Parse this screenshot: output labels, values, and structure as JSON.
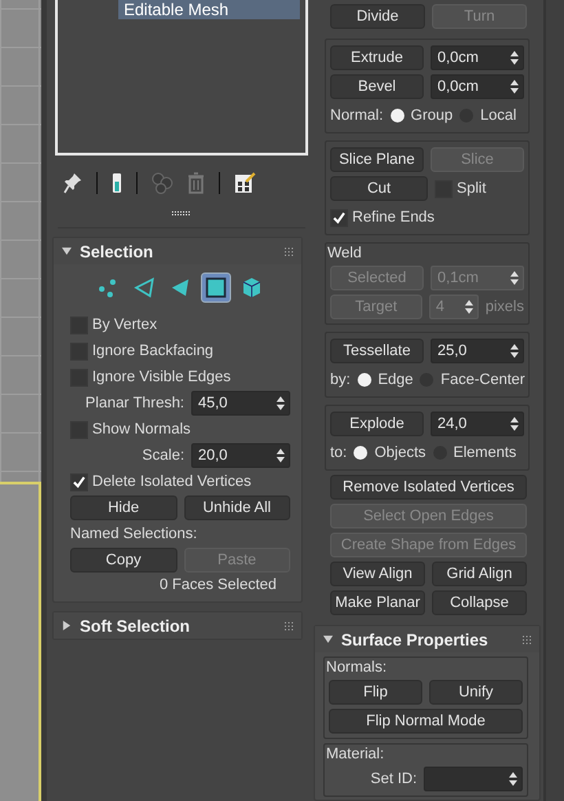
{
  "modifier_stack": {
    "items": [
      {
        "label": "Editable Mesh",
        "selected": true
      }
    ]
  },
  "selection": {
    "title": "Selection",
    "expanded": true,
    "levels": [
      {
        "selected": false
      },
      {
        "selected": false
      },
      {
        "selected": false
      },
      {
        "selected": true
      },
      {
        "selected": false
      }
    ],
    "rows": [
      {
        "kind": "check",
        "label": "By Vertex",
        "checked": false
      },
      {
        "kind": "check",
        "label": "Ignore Backfacing",
        "checked": false
      },
      {
        "kind": "check",
        "label": "Ignore Visible Edges",
        "checked": false
      },
      {
        "kind": "spinner",
        "label": "Planar Thresh:",
        "value": "45,0"
      },
      {
        "kind": "check",
        "label": "Show Normals",
        "checked": false
      },
      {
        "kind": "spinner",
        "label": "Scale:",
        "value": "20,0"
      },
      {
        "kind": "check",
        "label": "Delete Isolated Vertices",
        "checked": true
      },
      {
        "kind": "buttons",
        "buttons": [
          {
            "label": "Hide",
            "disabled": false
          },
          {
            "label": "Unhide All",
            "disabled": false
          }
        ]
      },
      {
        "kind": "label",
        "label": "Named Selections:"
      },
      {
        "kind": "buttons",
        "buttons": [
          {
            "label": "Copy",
            "disabled": false
          },
          {
            "label": "Paste",
            "disabled": true
          }
        ]
      },
      {
        "kind": "status",
        "label": "0 Faces Selected"
      }
    ]
  },
  "soft_selection": {
    "title": "Soft Selection",
    "expanded": false
  },
  "edit_geometry": [
    {
      "kind": "plain",
      "rows": [
        {
          "kind": "buttons",
          "buttons": [
            {
              "label": "Divide",
              "disabled": false
            },
            {
              "label": "Turn",
              "disabled": true
            }
          ]
        }
      ]
    },
    {
      "kind": "box",
      "rows": [
        {
          "kind": "button_spinner",
          "button": {
            "label": "Extrude",
            "disabled": false
          },
          "value": "0,0cm",
          "disabled": false
        },
        {
          "kind": "button_spinner",
          "button": {
            "label": "Bevel",
            "disabled": false
          },
          "value": "0,0cm",
          "disabled": false
        },
        {
          "kind": "radio",
          "label": "Normal:",
          "options": [
            {
              "label": "Group",
              "selected": true
            },
            {
              "label": "Local",
              "selected": false
            }
          ]
        }
      ]
    },
    {
      "kind": "box",
      "rows": [
        {
          "kind": "buttons",
          "buttons": [
            {
              "label": "Slice Plane",
              "disabled": false
            },
            {
              "label": "Slice",
              "disabled": true
            }
          ]
        },
        {
          "kind": "button_check",
          "button": {
            "label": "Cut",
            "disabled": false
          },
          "check": {
            "label": "Split",
            "checked": false
          }
        },
        {
          "kind": "check",
          "label": "Refine Ends",
          "checked": true
        }
      ]
    },
    {
      "kind": "box",
      "title": "Weld",
      "rows": [
        {
          "kind": "button_spinner",
          "button": {
            "label": "Selected",
            "disabled": true
          },
          "value": "0,1cm",
          "disabled": true
        },
        {
          "kind": "button_spinner",
          "button": {
            "label": "Target",
            "disabled": true
          },
          "value": "4",
          "unit": "pixels",
          "disabled": true
        }
      ]
    },
    {
      "kind": "box",
      "rows": [
        {
          "kind": "button_spinner",
          "button": {
            "label": "Tessellate",
            "disabled": false
          },
          "value": "25,0",
          "disabled": false
        },
        {
          "kind": "radio",
          "label": "by:",
          "options": [
            {
              "label": "Edge",
              "selected": true
            },
            {
              "label": "Face-Center",
              "selected": false
            }
          ]
        }
      ]
    },
    {
      "kind": "box",
      "rows": [
        {
          "kind": "button_spinner",
          "button": {
            "label": "Explode",
            "disabled": false
          },
          "value": "24,0",
          "disabled": false
        },
        {
          "kind": "radio",
          "label": "to:",
          "options": [
            {
              "label": "Objects",
              "selected": true
            },
            {
              "label": "Elements",
              "selected": false
            }
          ]
        }
      ]
    },
    {
      "kind": "plain",
      "rows": [
        {
          "kind": "buttons",
          "buttons": [
            {
              "label": "Remove Isolated Vertices",
              "disabled": false
            }
          ]
        },
        {
          "kind": "buttons",
          "buttons": [
            {
              "label": "Select Open Edges",
              "disabled": true
            }
          ]
        },
        {
          "kind": "buttons",
          "buttons": [
            {
              "label": "Create Shape from Edges",
              "disabled": true
            }
          ]
        },
        {
          "kind": "buttons",
          "buttons": [
            {
              "label": "View Align",
              "disabled": false
            },
            {
              "label": "Grid Align",
              "disabled": false
            }
          ]
        },
        {
          "kind": "buttons",
          "buttons": [
            {
              "label": "Make Planar",
              "disabled": false
            },
            {
              "label": "Collapse",
              "disabled": false
            }
          ]
        }
      ]
    }
  ],
  "surface_properties": {
    "title": "Surface Properties",
    "expanded": true,
    "groups": [
      {
        "kind": "box",
        "title": "Normals:",
        "rows": [
          {
            "kind": "buttons",
            "buttons": [
              {
                "label": "Flip",
                "disabled": false
              },
              {
                "label": "Unify",
                "disabled": false
              }
            ]
          },
          {
            "kind": "buttons",
            "buttons": [
              {
                "label": "Flip Normal Mode",
                "disabled": false
              }
            ]
          }
        ]
      },
      {
        "kind": "box",
        "title": "Material:",
        "rows": [
          {
            "kind": "spinner",
            "label": "Set ID:"
          }
        ]
      }
    ]
  }
}
